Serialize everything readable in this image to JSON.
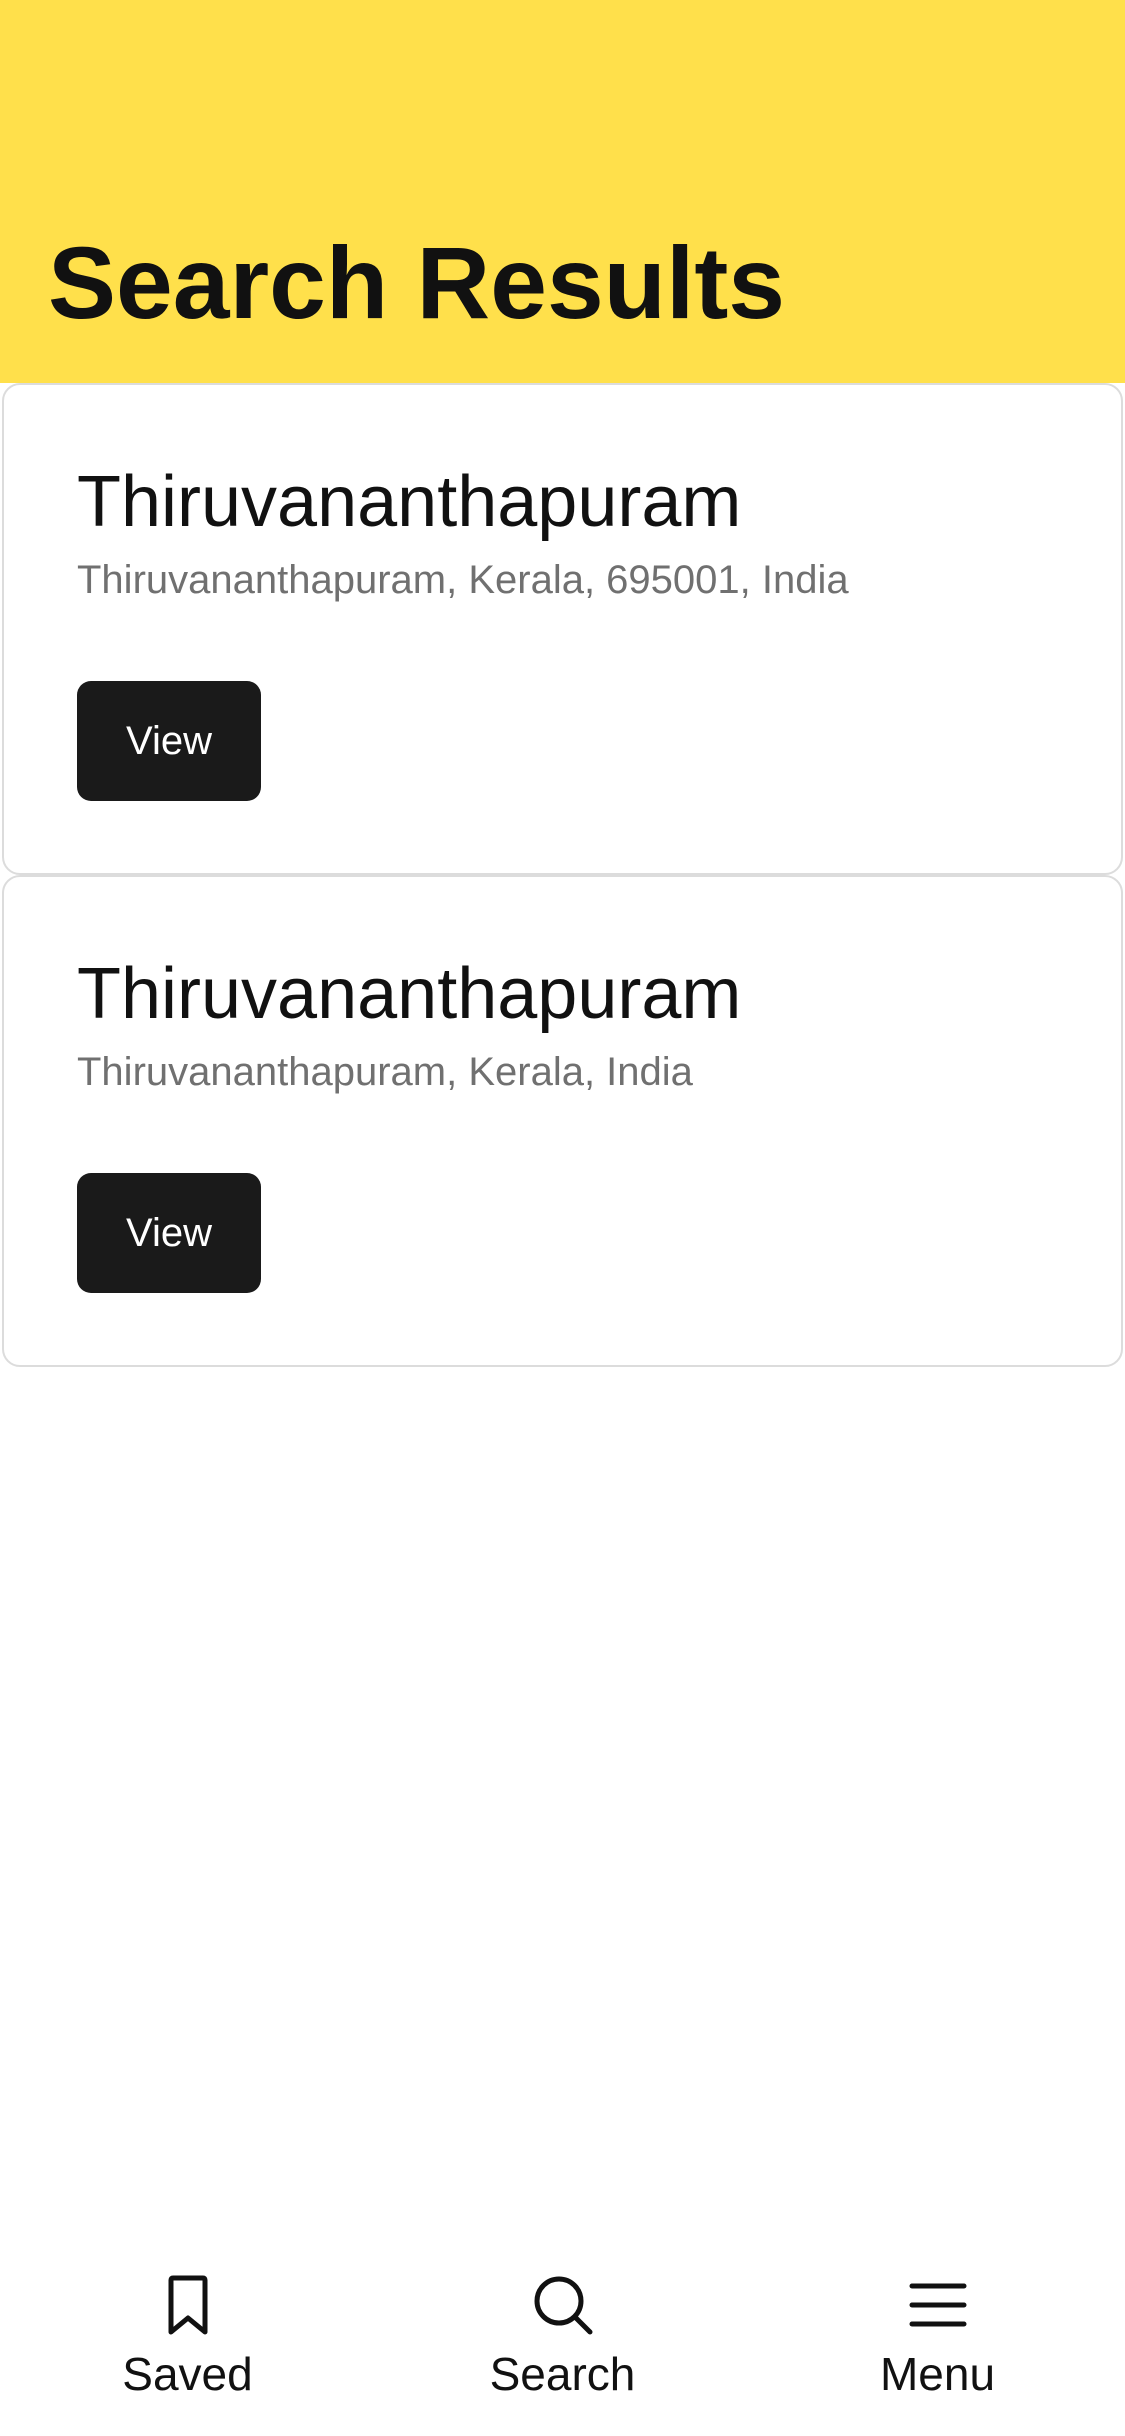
{
  "header": {
    "title": "Search Results",
    "background_color": "#FFE04B"
  },
  "results": [
    {
      "title": "Thiruvananthapuram",
      "subtitle": "Thiruvananthapuram, Kerala, 695001, India",
      "button_label": "View"
    },
    {
      "title": "Thiruvananthapuram",
      "subtitle": "Thiruvananthapuram, Kerala, India",
      "button_label": "View"
    }
  ],
  "bottom_nav": {
    "items": [
      {
        "label": "Saved",
        "icon": "bookmark-icon"
      },
      {
        "label": "Search",
        "icon": "search-icon"
      },
      {
        "label": "Menu",
        "icon": "menu-icon"
      }
    ]
  }
}
